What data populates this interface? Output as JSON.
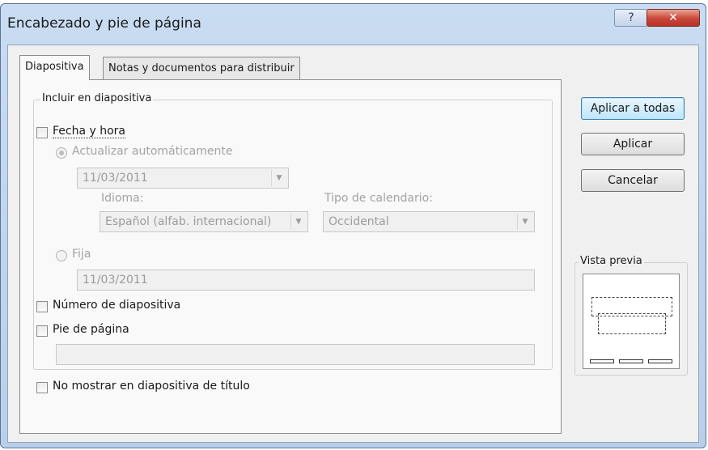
{
  "window": {
    "title": "Encabezado y pie de página",
    "help_label": "?",
    "close_label": "✕"
  },
  "tabs": [
    {
      "label": "Diapositiva",
      "active": true
    },
    {
      "label": "Notas y documentos para distribuir",
      "active": false
    }
  ],
  "include_group": {
    "legend": "Incluir en diapositiva",
    "date_time": {
      "label": "Fecha y hora",
      "checked": false
    },
    "auto_update": {
      "label": "Actualizar automáticamente",
      "selected": true
    },
    "date_value": "11/03/2011",
    "language": {
      "label": "Idioma:",
      "value": "Español (alfab. internacional)"
    },
    "calendar": {
      "label": "Tipo de calendario:",
      "value": "Occidental"
    },
    "fixed": {
      "label": "Fija",
      "selected": false
    },
    "fixed_value": "11/03/2011",
    "slide_number": {
      "label": "Número de diapositiva",
      "checked": false
    },
    "footer": {
      "label": "Pie de página",
      "checked": false,
      "value": ""
    }
  },
  "no_title_slide": {
    "label": "No mostrar en diapositiva de título",
    "checked": false
  },
  "buttons": {
    "apply_all": "Aplicar a todas",
    "apply": "Aplicar",
    "cancel": "Cancelar"
  },
  "preview": {
    "legend": "Vista previa"
  },
  "icons": {
    "help": "question-icon",
    "close": "close-icon",
    "dropdown": "chevron-down-icon"
  },
  "colors": {
    "titlebar": "#c9dcf1",
    "close": "#c9463a",
    "default_button": "#bee6fd"
  }
}
